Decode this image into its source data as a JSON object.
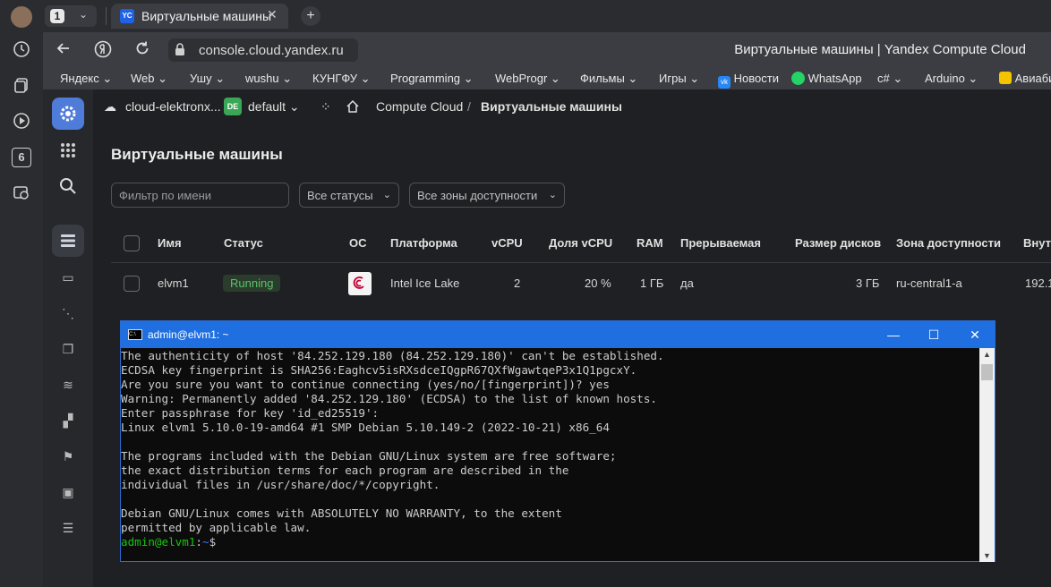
{
  "browser": {
    "tab_count": "1",
    "tab_favicon": "YC",
    "tab_title": "Виртуальные машины",
    "url": "console.cloud.yandex.ru",
    "page_title": "Виртуальные машины | Yandex Compute Cloud",
    "bookmarks": [
      "Яндекс",
      "Web",
      "Ушу",
      "wushu",
      "КУНГФУ",
      "Programming",
      "WebProgr",
      "Фильмы",
      "Игры",
      "Новости",
      "WhatsApp",
      "c#",
      "Arduino",
      "Авиаби"
    ],
    "side_badge": "6"
  },
  "console": {
    "cloud": "cloud-elektronx...",
    "folder_badge": "DE",
    "folder": "default",
    "service": "Compute Cloud",
    "crumb_sep": "/",
    "page": "Виртуальные машины",
    "heading": "Виртуальные машины",
    "filters": {
      "name_placeholder": "Фильтр по имени",
      "status": "Все статусы",
      "zone": "Все зоны доступности"
    },
    "columns": [
      "Имя",
      "Статус",
      "ОС",
      "Платформа",
      "vCPU",
      "Доля vCPU",
      "RAM",
      "Прерываемая",
      "Размер дисков",
      "Зона доступности",
      "Внутр"
    ],
    "rows": [
      {
        "name": "elvm1",
        "status": "Running",
        "platform": "Intel Ice Lake",
        "vcpu": "2",
        "vcpu_share": "20 %",
        "ram": "1 ГБ",
        "preemptible": "да",
        "disk": "3 ГБ",
        "zone": "ru-central1-a",
        "ip": "192.1"
      }
    ]
  },
  "terminal": {
    "title": "admin@elvm1: ~",
    "icon_label": "C:\\",
    "lines": [
      "The authenticity of host '84.252.129.180 (84.252.129.180)' can't be established.",
      "ECDSA key fingerprint is SHA256:Eaghcv5isRXsdceIQgpR67QXfWgawtqeP3x1Q1pgcxY.",
      "Are you sure you want to continue connecting (yes/no/[fingerprint])? yes",
      "Warning: Permanently added '84.252.129.180' (ECDSA) to the list of known hosts.",
      "Enter passphrase for key 'id_ed25519':",
      "Linux elvm1 5.10.0-19-amd64 #1 SMP Debian 5.10.149-2 (2022-10-21) x86_64",
      "",
      "The programs included with the Debian GNU/Linux system are free software;",
      "the exact distribution terms for each program are described in the",
      "individual files in /usr/share/doc/*/copyright.",
      "",
      "Debian GNU/Linux comes with ABSOLUTELY NO WARRANTY, to the extent",
      "permitted by applicable law."
    ],
    "prompt_user": "admin@elvm1",
    "prompt_sep": ":",
    "prompt_path": "~",
    "prompt_end": "$"
  },
  "colors": {
    "terminal_titlebar": "#1f6fe0",
    "status_running": "#5cc06a",
    "prompt_green": "#16c60c",
    "prompt_blue": "#3b78ff"
  }
}
